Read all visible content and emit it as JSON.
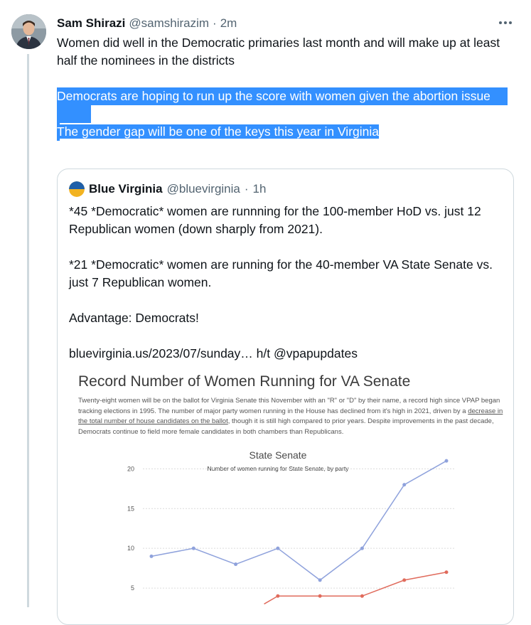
{
  "tweet": {
    "author_name": "Sam Shirazi",
    "handle": "@samshirazim",
    "separator": "·",
    "time": "2m",
    "paragraphs": [
      "Women did well in the Democratic primaries last month and will make up at least half the nominees in the districts",
      "Democrats are hoping to run up the score with women given the abortion issue",
      "The gender gap will be one of the keys this year in Virginia"
    ]
  },
  "quote": {
    "author_name": "Blue Virginia",
    "handle": "@bluevirginia",
    "separator": "·",
    "time": "1h",
    "paragraphs": [
      "*45 *Democratic* women are runnning for the 100-member HoD vs. just 12 Republican women (down sharply from 2021).",
      "*21 *Democratic* women are running for the 40-member VA State Senate vs. just 7 Republican women.",
      "Advantage: Democrats!",
      "bluevirginia.us/2023/07/sunday… h/t @vpapupdates"
    ]
  },
  "image": {
    "title": "Record Number of Women Running for VA Senate",
    "desc_before": "Twenty-eight women will be on the ballot for Virginia Senate this November with an \"R\" or \"D\" by their name, a record high since VPAP began tracking elections in 1995. The number of major party women running in the House has declined from it's high in 2021, driven by a ",
    "desc_link": "decrease in the total number of house candidates on the ballot",
    "desc_after": ", though it is still high compared to prior years. Despite improvements in the past decade, Democrats continue to field more female candidates in both chambers than Republicans."
  },
  "chart_data": {
    "type": "line",
    "title": "State Senate",
    "subtitle": "Number of women running for State Senate, by party",
    "x": [
      1,
      2,
      3,
      4,
      5,
      6,
      7,
      8
    ],
    "series": [
      {
        "values": [
          9,
          10,
          8,
          10,
          6,
          10,
          18,
          21
        ],
        "color": "#8fa2dc"
      },
      {
        "values": [
          null,
          null,
          null,
          4,
          4,
          4,
          6,
          7
        ],
        "color": "#e06b5c"
      }
    ],
    "y_ticks": [
      "20",
      "15",
      "10",
      "5"
    ],
    "ylim": [
      0,
      22
    ],
    "grid": true
  }
}
